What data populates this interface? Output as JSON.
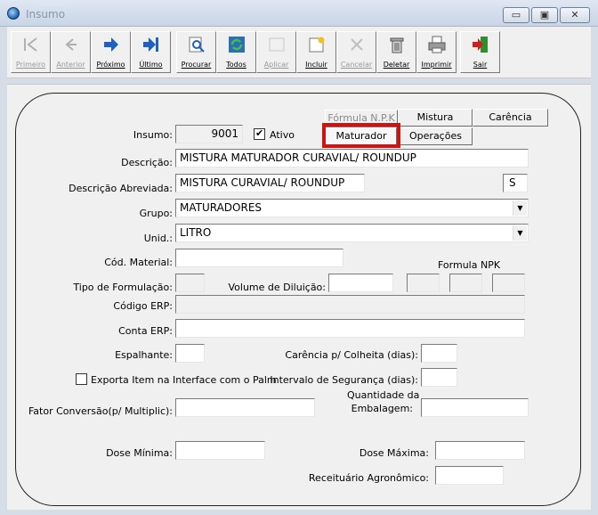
{
  "window": {
    "title": "Insumo",
    "min_glyph": "▭",
    "max_glyph": "▣",
    "close_glyph": "✕"
  },
  "toolbar": [
    {
      "key": "primeiro",
      "label": "Primeiro",
      "icon": "first-record-icon",
      "enabled": false
    },
    {
      "key": "anterior",
      "label": "Anterior",
      "icon": "previous-record-icon",
      "enabled": false
    },
    {
      "key": "proximo",
      "label": "Próximo",
      "icon": "next-record-icon",
      "enabled": true
    },
    {
      "key": "ultimo",
      "label": "Último",
      "icon": "last-record-icon",
      "enabled": true
    },
    {
      "key": "procurar",
      "label": "Procurar",
      "icon": "search-icon",
      "enabled": true
    },
    {
      "key": "todos",
      "label": "Todos",
      "icon": "refresh-all-icon",
      "enabled": true
    },
    {
      "key": "aplicar",
      "label": "Aplicar",
      "icon": "apply-icon",
      "enabled": false
    },
    {
      "key": "incluir",
      "label": "Incluir",
      "icon": "new-record-icon",
      "enabled": true
    },
    {
      "key": "cancelar",
      "label": "Cancelar",
      "icon": "cancel-icon",
      "enabled": false
    },
    {
      "key": "deletar",
      "label": "Deletar",
      "icon": "trash-icon",
      "enabled": true
    },
    {
      "key": "imprimir",
      "label": "Imprimir",
      "icon": "printer-icon",
      "enabled": true
    },
    {
      "key": "sair",
      "label": "Sair",
      "icon": "exit-door-icon",
      "enabled": true
    }
  ],
  "tabs": {
    "formula_npk": "Fórmula N.P.K",
    "mistura": "Mistura",
    "carencia": "Carência",
    "maturador": "Maturador",
    "operacoes": "Operações"
  },
  "form": {
    "insumo_label": "Insumo:",
    "insumo_value": "9001",
    "ativo_label": "Ativo",
    "ativo_mark": "✔",
    "descricao_label": "Descrição:",
    "descricao_value": "MISTURA MATURADOR CURAVIAL/ ROUNDUP",
    "descricao_abrev_label": "Descrição Abreviada:",
    "descricao_abrev_value": "MISTURA CURAVIAL/ ROUNDUP",
    "descricao_abrev_flag": "S",
    "grupo_label": "Grupo:",
    "grupo_value": "MATURADORES",
    "unid_label": "Unid.:",
    "unid_value": "LITRO",
    "cod_material_label": "Cód. Material:",
    "formula_npk_label": "Formula NPK",
    "tipo_formulacao_label": "Tipo de Formulação:",
    "volume_diluicao_label": "Volume de Diluição:",
    "codigo_erp_label": "Código ERP:",
    "conta_erp_label": "Conta ERP:",
    "espalhante_label": "Espalhante:",
    "carencia_colheita_label": "Carência p/ Colheita (dias):",
    "exporta_palm_label": "Exporta Item na Interface com o Palm",
    "intervalo_seguranca_label": "Intervalo de Segurança (dias):",
    "qtd_embalagem_label_1": "Quantidade da",
    "qtd_embalagem_label_2": "Embalagem:",
    "fator_conversao_label": "Fator Conversão(p/ Multiplic):",
    "dose_minima_label": "Dose Mínima:",
    "dose_maxima_label": "Dose Máxima:",
    "receituario_label": "Receituário Agronômico:",
    "dropdown_glyph": "▼"
  },
  "colors": {
    "highlight": "#cc1414",
    "window_bg": "#f0f0f0"
  }
}
